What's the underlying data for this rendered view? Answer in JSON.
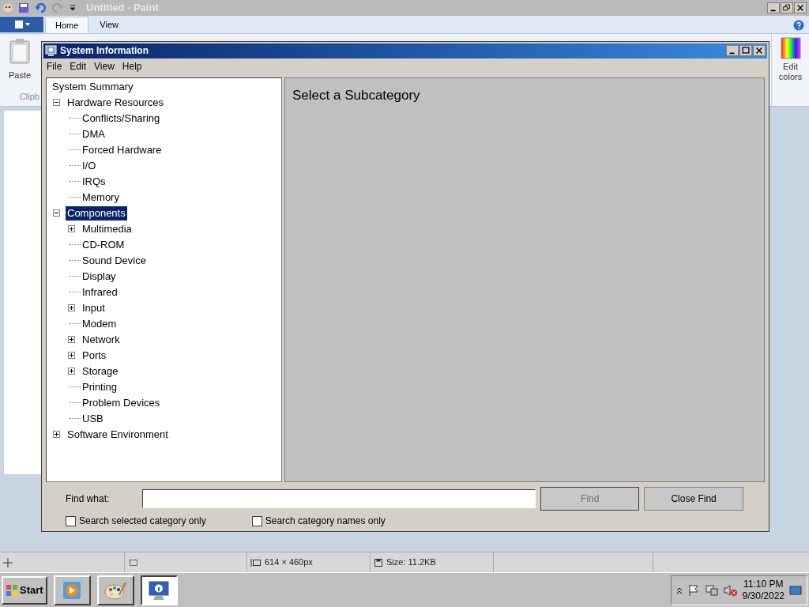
{
  "paint": {
    "title": "Untitled - Paint",
    "tabs": [
      {
        "label": "Home",
        "selected": true
      },
      {
        "label": "View",
        "selected": false
      }
    ],
    "paste": "Paste",
    "group_label": "Clipb",
    "edit_colors": "Edit colors",
    "status_bar": [
      "614 × 460px",
      "Size: 11.2KB"
    ]
  },
  "window": {
    "title": "System Information",
    "menu": [
      "File",
      "Edit",
      "View",
      "Help"
    ],
    "tree": [
      {
        "label": "System Summary",
        "selected": false,
        "children": [
          {
            "label": "Hardware Resources",
            "selected": false,
            "expanded": true,
            "children": [
              {
                "label": "Conflicts/Sharing",
                "selected": false
              },
              {
                "label": "DMA",
                "selected": false
              },
              {
                "label": "Forced Hardware",
                "selected": false
              },
              {
                "label": "I/O",
                "selected": false
              },
              {
                "label": "IRQs",
                "selected": false
              },
              {
                "label": "Memory",
                "selected": false
              }
            ]
          },
          {
            "label": "Components",
            "selected": true,
            "expanded": true,
            "children": [
              {
                "label": "Multimedia",
                "selected": false,
                "expanded": false
              },
              {
                "label": "CD-ROM",
                "selected": false
              },
              {
                "label": "Sound Device",
                "selected": false
              },
              {
                "label": "Display",
                "selected": false
              },
              {
                "label": "Infrared",
                "selected": false
              },
              {
                "label": "Input",
                "selected": false,
                "expanded": false
              },
              {
                "label": "Modem",
                "selected": false
              },
              {
                "label": "Network",
                "selected": false,
                "expanded": false
              },
              {
                "label": "Ports",
                "selected": false,
                "expanded": false
              },
              {
                "label": "Storage",
                "selected": false,
                "expanded": false
              },
              {
                "label": "Printing",
                "selected": false
              },
              {
                "label": "Problem Devices",
                "selected": false
              },
              {
                "label": "USB",
                "selected": false
              }
            ]
          },
          {
            "label": "Software Environment",
            "selected": false,
            "expanded": false
          }
        ]
      }
    ],
    "detail_heading": "Select a Subcategory",
    "find_label": "Find what:",
    "find_button": {
      "label": "Find",
      "disabled": true
    },
    "close_find": "Close Find",
    "options": [
      {
        "label": "Search selected category only",
        "checked": false
      },
      {
        "label": "Search category names only",
        "checked": false
      }
    ]
  },
  "taskbar": {
    "start": "Start",
    "tasks": [
      {
        "kind": "media",
        "selected": false
      },
      {
        "kind": "paint",
        "selected": false
      },
      {
        "kind": "sysinfo",
        "selected": true
      }
    ],
    "time": "11:10 PM",
    "date": "9/30/2022"
  }
}
